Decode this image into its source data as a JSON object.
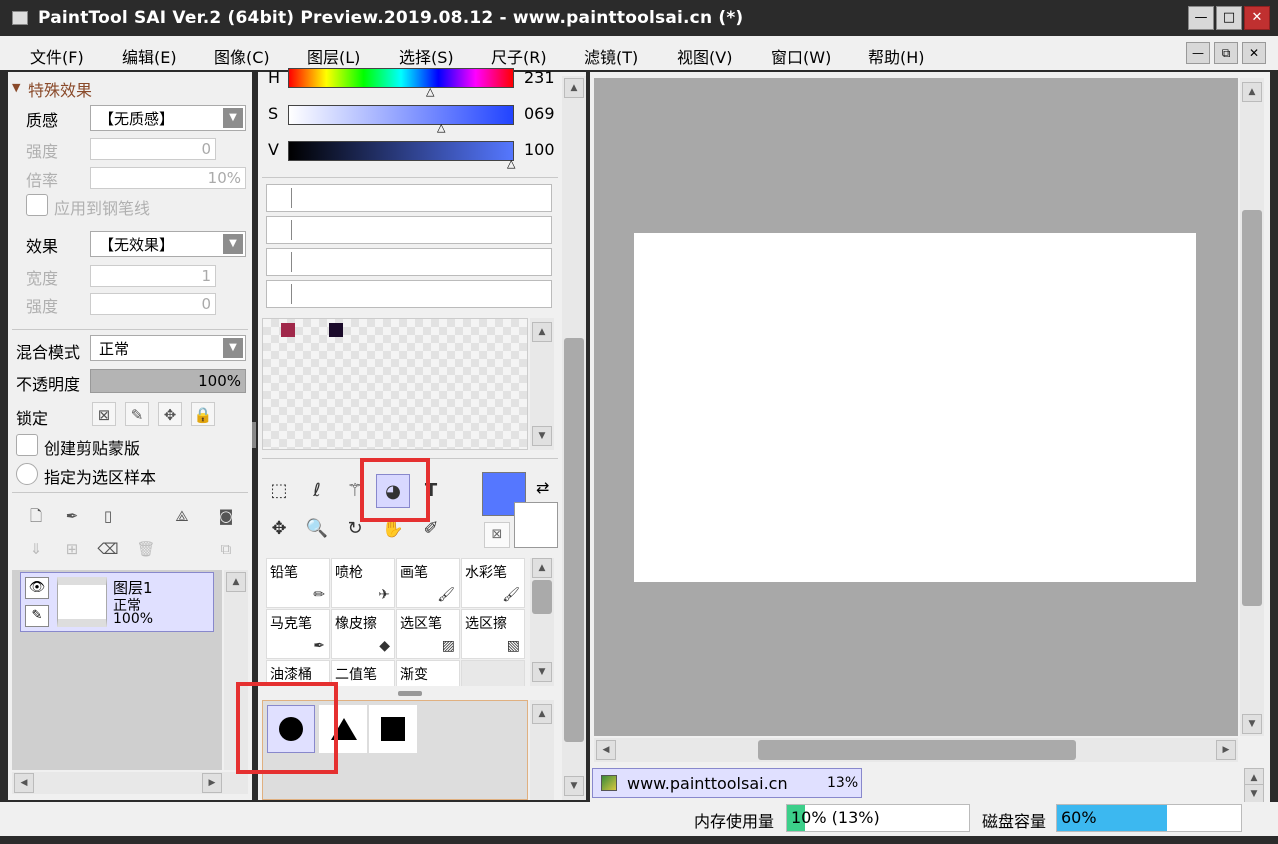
{
  "window": {
    "title": "PaintTool SAI Ver.2 (64bit) Preview.2019.08.12 - www.painttoolsai.cn (*)",
    "min_glyph": "—",
    "max_glyph": "□",
    "close_glyph": "✕"
  },
  "menu": [
    "文件(F)",
    "编辑(E)",
    "图像(C)",
    "图层(L)",
    "选择(S)",
    "尺子(R)",
    "滤镜(T)",
    "视图(V)",
    "窗口(W)",
    "帮助(H)"
  ],
  "left_panel": {
    "section_title": "特殊效果",
    "texture_label": "质感",
    "texture_value": "【无质感】",
    "strength_label": "强度",
    "strength_value": "0",
    "scale_label": "倍率",
    "scale_value": "10%",
    "apply_pen_label": "应用到钢笔线",
    "effect_label": "效果",
    "effect_value": "【无效果】",
    "width_label": "宽度",
    "width_value": "1",
    "strength2_label": "强度",
    "strength2_value": "0",
    "blend_label": "混合模式",
    "blend_value": "正常",
    "opacity_label": "不透明度",
    "opacity_value": "100%",
    "lock_label": "锁定",
    "clip_label": "创建剪贴蒙版",
    "sample_label": "指定为选区样本",
    "layer": {
      "name": "图层1",
      "mode": "正常",
      "opacity": "100%"
    }
  },
  "color_panel": {
    "h_label": "H",
    "h_value": "231",
    "s_label": "S",
    "s_value": "069",
    "v_label": "V",
    "v_value": "100",
    "swatches": [
      "#a0284a",
      "#1a0a2a"
    ],
    "primary_color": "#5577ff"
  },
  "brushes": [
    {
      "name": "铅笔",
      "icon": "pencil-icon"
    },
    {
      "name": "喷枪",
      "icon": "airbrush-icon"
    },
    {
      "name": "画笔",
      "icon": "brush-icon"
    },
    {
      "name": "水彩笔",
      "icon": "watercolor-icon"
    },
    {
      "name": "马克笔",
      "icon": "marker-icon"
    },
    {
      "name": "橡皮擦",
      "icon": "eraser-icon"
    },
    {
      "name": "选区笔",
      "icon": "select-pen-icon"
    },
    {
      "name": "选区擦",
      "icon": "select-eraser-icon"
    },
    {
      "name": "油漆桶",
      "icon": "bucket-icon"
    },
    {
      "name": "二值笔",
      "icon": "binary-pen-icon"
    },
    {
      "name": "渐变",
      "icon": "gradient-icon"
    }
  ],
  "canvas_tab": {
    "name": "www.painttoolsai.cn",
    "zoom": "13%"
  },
  "status": {
    "memory_label": "内存使用量",
    "memory_value": "10% (13%)",
    "memory_fraction": 0.1,
    "disk_label": "磁盘容量",
    "disk_value": "60%",
    "disk_fraction": 0.6
  }
}
